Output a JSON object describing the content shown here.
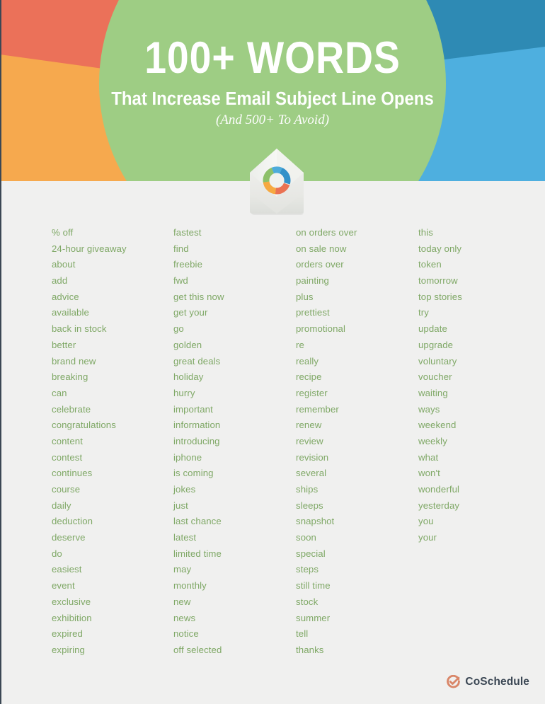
{
  "header": {
    "title": "100+ WORDS",
    "subtitle": "That Increase Email Subject Line Opens",
    "note": "(And 500+ To Avoid)",
    "logo_icon": "open-envelope-with-donut-chart-icon",
    "colors": {
      "red": "#eb7159",
      "orange": "#f6a94e",
      "green_circle": "#9ecd84",
      "blue_dark": "#2e8ab4",
      "blue_light": "#4eafdf",
      "page_background": "#f0f0ef",
      "left_rule": "#3b4754"
    },
    "donut_segments": [
      "#3391c9",
      "#ea7253",
      "#f6a941",
      "#8dc06a",
      "#4dabda"
    ]
  },
  "words": {
    "text_color": "#7fa866",
    "columns": [
      {
        "name": "column-1",
        "items": [
          "% off",
          "24-hour giveaway",
          "about",
          "add",
          "advice",
          "available",
          "back in stock",
          "better",
          "brand new",
          "breaking",
          "can",
          "celebrate",
          "congratulations",
          "content",
          "contest",
          "continues",
          "course",
          "daily",
          "deduction",
          "deserve",
          "do",
          "easiest",
          "event",
          "exclusive",
          "exhibition",
          "expired",
          "expiring"
        ]
      },
      {
        "name": "column-2",
        "items": [
          "fastest",
          "find",
          "freebie",
          "fwd",
          "get this now",
          "get your",
          "go",
          "golden",
          "great deals",
          "holiday",
          "hurry",
          "important",
          "information",
          "introducing",
          "iphone",
          "is coming",
          "jokes",
          "just",
          "last chance",
          "latest",
          "limited time",
          "may",
          "monthly",
          "new",
          "news",
          "notice",
          "off selected"
        ]
      },
      {
        "name": "column-3",
        "items": [
          "on orders over",
          "on sale now",
          "orders over",
          "painting",
          "plus",
          "prettiest",
          "promotional",
          "re",
          "really",
          "recipe",
          "register",
          "remember",
          "renew",
          "review",
          "revision",
          "several",
          "ships",
          "sleeps",
          "snapshot",
          "soon",
          "special",
          "steps",
          "still time",
          "stock",
          "summer",
          "tell",
          "thanks"
        ]
      },
      {
        "name": "column-4",
        "items": [
          "this",
          "today only",
          "token",
          "tomorrow",
          "top stories",
          "try",
          "update",
          "upgrade",
          "voluntary",
          "voucher",
          "waiting",
          "ways",
          "weekend",
          "weekly",
          "what",
          "won't",
          "wonderful",
          "yesterday",
          "you",
          "your"
        ]
      }
    ]
  },
  "footer": {
    "brand": "CoSchedule",
    "brand_icon": "coschedule-check-circle-icon",
    "brand_icon_color": "#d98668",
    "brand_text_color": "#3b4754"
  }
}
